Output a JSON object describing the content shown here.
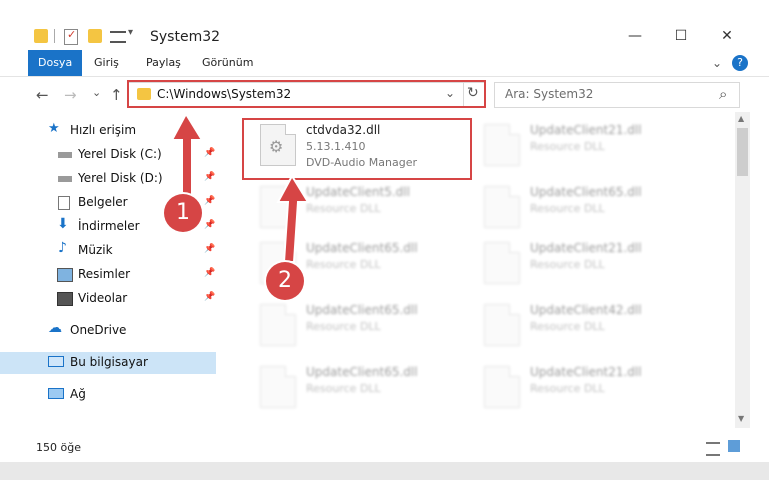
{
  "window": {
    "title": "System32",
    "minimize": "—",
    "maximize": "☐",
    "close": "✕"
  },
  "ribbon": {
    "tabs": [
      "Dosya",
      "Giriş",
      "Paylaş",
      "Görünüm"
    ],
    "help": "?"
  },
  "nav": {
    "back": "←",
    "forward": "→",
    "recent": "⌄",
    "up": "↑",
    "address": "C:\\Windows\\System32",
    "dropdown": "⌄",
    "refresh": "↻",
    "search_placeholder": "Ara: System32",
    "search_icon": "⌕"
  },
  "sidebar": {
    "items": [
      {
        "label": "Hızlı erişim",
        "icon": "star-icon"
      },
      {
        "label": "Yerel Disk (C:)",
        "icon": "drive-icon",
        "pinned": true
      },
      {
        "label": "Yerel Disk (D:)",
        "icon": "drive-icon",
        "pinned": true
      },
      {
        "label": "Belgeler",
        "icon": "document-icon",
        "pinned": true
      },
      {
        "label": "İndirmeler",
        "icon": "download-icon",
        "pinned": true
      },
      {
        "label": "Müzik",
        "icon": "music-icon",
        "pinned": true
      },
      {
        "label": "Resimler",
        "icon": "picture-icon",
        "pinned": true
      },
      {
        "label": "Videolar",
        "icon": "video-icon",
        "pinned": true
      },
      {
        "label": "OneDrive",
        "icon": "cloud-icon"
      },
      {
        "label": "Bu bilgisayar",
        "icon": "computer-icon",
        "selected": true
      },
      {
        "label": "Ağ",
        "icon": "network-icon"
      }
    ]
  },
  "files": {
    "main": {
      "name": "ctdvda32.dll",
      "version": "5.13.1.410",
      "description": "DVD-Audio Manager"
    },
    "right_col": [
      {
        "name": "UpdateClient21.dll",
        "type": "Resource DLL"
      },
      {
        "name": "UpdateClient65.dll",
        "type": "Resource DLL"
      },
      {
        "name": "UpdateClient21.dll",
        "type": "Resource DLL"
      },
      {
        "name": "UpdateClient42.dll",
        "type": "Resource DLL"
      },
      {
        "name": "UpdateClient21.dll",
        "type": "Resource DLL"
      }
    ],
    "left_col": [
      {
        "name": "UpdateClient5.dll",
        "type": "Resource DLL"
      },
      {
        "name": "UpdateClient65.dll",
        "type": "Resource DLL"
      },
      {
        "name": "UpdateClient65.dll",
        "type": "Resource DLL"
      },
      {
        "name": "UpdateClient65.dll",
        "type": "Resource DLL"
      }
    ]
  },
  "status": {
    "count": "150 öğe"
  },
  "annotations": {
    "step1": "1",
    "step2": "2",
    "color": "#d64545"
  }
}
